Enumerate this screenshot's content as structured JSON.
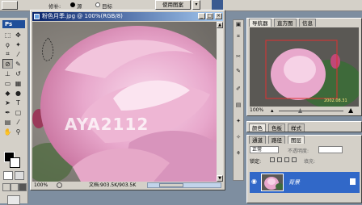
{
  "options_bar": {
    "mode_label": "修补:",
    "source_label": "源",
    "target_label": "目标",
    "use_pattern_label": "使用图案"
  },
  "toolbox": {
    "logo": "Ps"
  },
  "document": {
    "title": "粉色月季.jpg @ 100%(RGB/8)",
    "zoom": "100%",
    "doc_size": "文档:903.5K/903.5K",
    "watermark": "AYA2112"
  },
  "navigator": {
    "tabs": [
      "导航器",
      "直方图",
      "信息"
    ],
    "date_stamp": "2002.08.31",
    "zoom": "100%"
  },
  "color_panel": {
    "tabs": [
      "颜色",
      "色板",
      "样式"
    ]
  },
  "layers_panel": {
    "tabs": [
      "通道",
      "路径",
      "图层"
    ],
    "blend_mode": "正常",
    "opacity_label": "不透明度:",
    "lock_label": "锁定:",
    "fill_label": "填充:",
    "layer_name": "背景"
  },
  "colors": {
    "title_start": "#0a246a",
    "title_end": "#a6caf0",
    "chrome": "#d4d0c8",
    "selected_layer": "#3168c8"
  }
}
